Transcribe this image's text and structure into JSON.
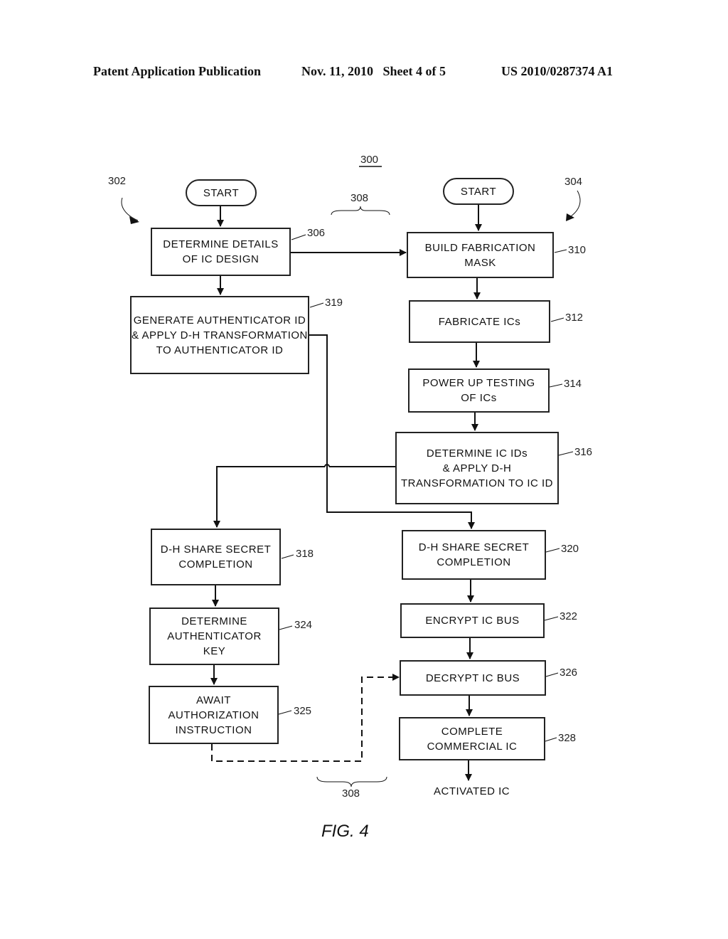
{
  "header": {
    "left": "Patent Application Publication",
    "date_sheet": "Nov. 11, 2010   Sheet 4 of 5",
    "number": "US 2010/0287374 A1"
  },
  "figure": {
    "label": "FIG. 4",
    "ref_main": "300",
    "ref_left_flow": "302",
    "ref_right_flow": "304",
    "ref_bracket_top": "308",
    "ref_bracket_bottom": "308"
  },
  "nodes": {
    "start_left": {
      "text": "START"
    },
    "start_right": {
      "text": "START"
    },
    "n306": {
      "text": "DETERMINE DETAILS\nOF IC DESIGN",
      "ref": "306"
    },
    "n319": {
      "text": "GENERATE AUTHENTICATOR ID\n& APPLY D-H TRANSFORMATION\nTO AUTHENTICATOR ID",
      "ref": "319"
    },
    "n310": {
      "text": "BUILD FABRICATION\nMASK",
      "ref": "310"
    },
    "n312": {
      "text": "FABRICATE ICs",
      "ref": "312"
    },
    "n314": {
      "text": "POWER UP TESTING\nOF ICs",
      "ref": "314"
    },
    "n316": {
      "text": "DETERMINE IC IDs\n& APPLY D-H\nTRANSFORMATION TO IC ID",
      "ref": "316"
    },
    "n318": {
      "text": "D-H SHARE SECRET\nCOMPLETION",
      "ref": "318"
    },
    "n320": {
      "text": "D-H SHARE SECRET\nCOMPLETION",
      "ref": "320"
    },
    "n324": {
      "text": "DETERMINE\nAUTHENTICATOR\nKEY",
      "ref": "324"
    },
    "n322": {
      "text": "ENCRYPT IC BUS",
      "ref": "322"
    },
    "n325": {
      "text": "AWAIT\nAUTHORIZATION\nINSTRUCTION",
      "ref": "325"
    },
    "n326": {
      "text": "DECRYPT IC BUS",
      "ref": "326"
    },
    "n328": {
      "text": "COMPLETE\nCOMMERCIAL IC",
      "ref": "328"
    },
    "end": {
      "text": "ACTIVATED IC"
    }
  }
}
